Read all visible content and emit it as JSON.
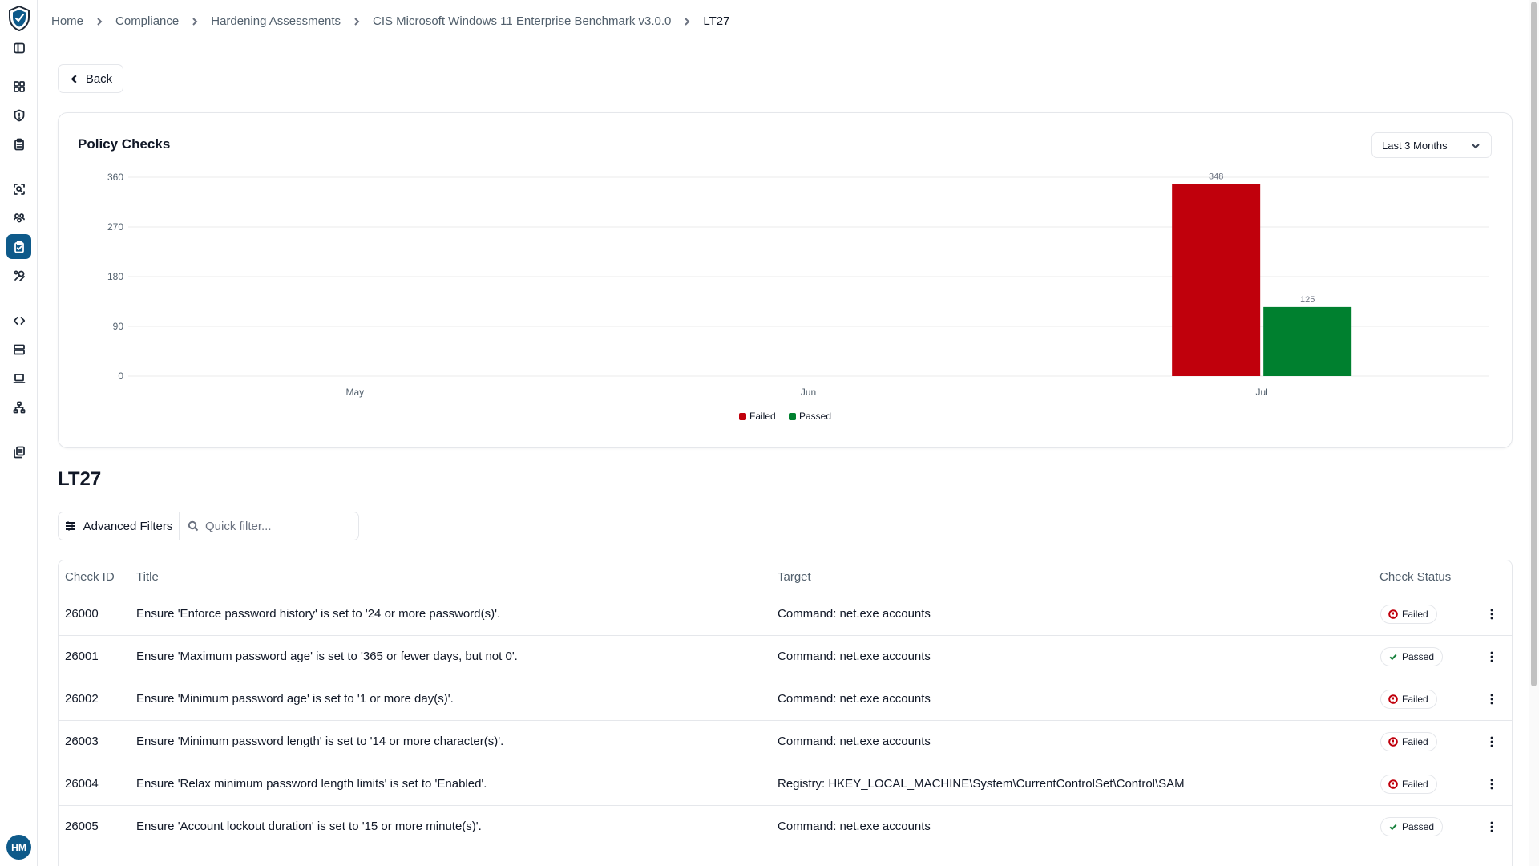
{
  "breadcrumb": [
    {
      "label": "Home"
    },
    {
      "label": "Compliance"
    },
    {
      "label": "Hardening Assessments"
    },
    {
      "label": "CIS Microsoft Windows 11 Enterprise Benchmark v3.0.0"
    },
    {
      "label": "LT27"
    }
  ],
  "back_label": "Back",
  "user": {
    "initials": "HM"
  },
  "sidebar": {
    "icons": [
      "panel-toggle-icon",
      "dashboard-icon",
      "shield-icon",
      "clipboard-icon",
      "scan-icon",
      "users-group-icon",
      "clipboard-check-icon",
      "tools-icon",
      "code-icon",
      "server-icon",
      "laptop-icon",
      "network-icon",
      "reports-icon"
    ],
    "active": "clipboard-check-icon"
  },
  "chart_card": {
    "title": "Policy Checks",
    "range": {
      "selected": "Last 3 Months"
    }
  },
  "chart_data": {
    "type": "bar",
    "title": "Policy Checks",
    "categories": [
      "May",
      "Jun",
      "Jul"
    ],
    "series": [
      {
        "name": "Failed",
        "color": "#c0000c",
        "values": [
          0,
          0,
          348
        ]
      },
      {
        "name": "Passed",
        "color": "#00802f",
        "values": [
          0,
          0,
          125
        ]
      }
    ],
    "yticks": [
      "0",
      "90",
      "180",
      "270",
      "360"
    ],
    "ylim": [
      0,
      360
    ],
    "data_labels": [
      "348",
      "125"
    ],
    "grid": true,
    "legend": "bottom-center"
  },
  "section": {
    "title": "LT27",
    "advanced_filters_label": "Advanced Filters",
    "quick_filter_placeholder": "Quick filter..."
  },
  "table": {
    "columns": [
      "Check ID",
      "Title",
      "Target",
      "Check Status"
    ],
    "rows": [
      {
        "id": "26000",
        "title": "Ensure 'Enforce password history' is set to '24 or more password(s)'.",
        "target": "Command: net.exe accounts",
        "status": "Failed"
      },
      {
        "id": "26001",
        "title": "Ensure 'Maximum password age' is set to '365 or fewer days, but not 0'.",
        "target": "Command: net.exe accounts",
        "status": "Passed"
      },
      {
        "id": "26002",
        "title": "Ensure 'Minimum password age' is set to '1 or more day(s)'.",
        "target": "Command: net.exe accounts",
        "status": "Failed"
      },
      {
        "id": "26003",
        "title": "Ensure 'Minimum password length' is set to '14 or more character(s)'.",
        "target": "Command: net.exe accounts",
        "status": "Failed"
      },
      {
        "id": "26004",
        "title": "Ensure 'Relax minimum password length limits' is set to 'Enabled'.",
        "target": "Registry: HKEY_LOCAL_MACHINE\\System\\CurrentControlSet\\Control\\SAM",
        "status": "Failed"
      },
      {
        "id": "26005",
        "title": "Ensure 'Account lockout duration' is set to '15 or more minute(s)'.",
        "target": "Command: net.exe accounts",
        "status": "Passed"
      }
    ]
  },
  "colors": {
    "accent": "#0e5a8a",
    "failed": "#c0000c",
    "passed": "#00802f"
  }
}
